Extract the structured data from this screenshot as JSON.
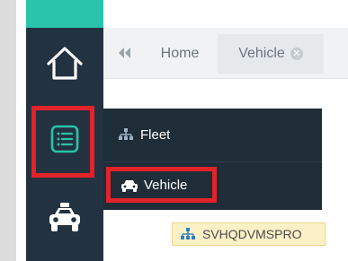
{
  "tabs": {
    "collapse_icon": "double-chevron-left-icon",
    "home_label": "Home",
    "vehicle_label": "Vehicle",
    "vehicle_close_icon": "close-circle-icon"
  },
  "rail": {
    "home_icon": "house-outline-icon",
    "list_icon": "list-icon",
    "car_icon": "car-icon"
  },
  "menu": {
    "fleet_label": "Fleet",
    "fleet_icon": "org-chart-icon",
    "vehicle_label": "Vehicle",
    "vehicle_icon": "car-icon"
  },
  "tree": {
    "node_label": "SVHQDVMSPRO",
    "node_icon": "org-chart-icon"
  },
  "colors": {
    "rail_background": "#233240",
    "rail_accent": "#29c4a9",
    "flyout_background": "#1f2d38",
    "highlight_red": "#e32229",
    "tree_node_background": "#fbf0c6"
  }
}
